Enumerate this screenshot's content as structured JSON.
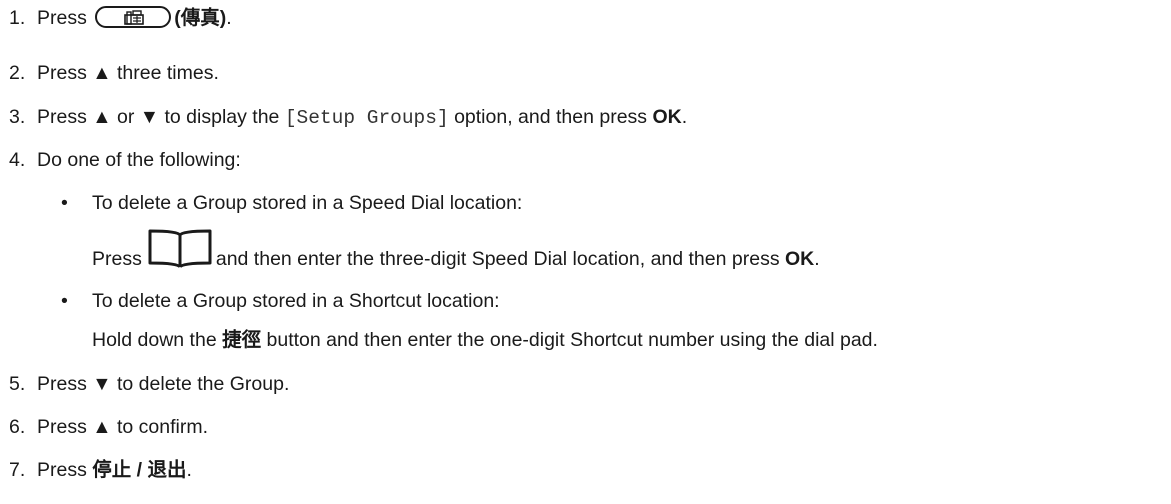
{
  "steps": [
    {
      "num": "1.",
      "pre": "Press",
      "label": "(傳真)",
      "post": "."
    },
    {
      "num": "2.",
      "pre": "Press ",
      "arrow": "▲",
      "post": " three times."
    },
    {
      "num": "3.",
      "pre": "Press ",
      "arrow_up": "▲",
      "mid1": " or ",
      "arrow_down": "▼",
      "mid2": " to display the ",
      "code": "[Setup Groups]",
      "mid3": " option, and then press ",
      "bold": "OK",
      "post": "."
    },
    {
      "num": "4.",
      "text": "Do one of the following:"
    },
    {
      "num": "5.",
      "pre": "Press ",
      "arrow": "▼",
      "post": " to delete the Group."
    },
    {
      "num": "6.",
      "pre": "Press ",
      "arrow": "▲",
      "post": " to confirm."
    },
    {
      "num": "7.",
      "pre": "Press ",
      "bold": "停止 / 退出",
      "post": "."
    }
  ],
  "options": [
    {
      "bullet": "•",
      "heading": "To delete a Group stored in a Speed Dial location:",
      "pre": "Press",
      "mid": "and then enter the three-digit Speed Dial location, and then press ",
      "bold": "OK",
      "post": "."
    },
    {
      "bullet": "•",
      "heading": "To delete a Group stored in a Shortcut location:",
      "pre": "Hold down the ",
      "bold": "捷徑",
      "post": " button and then enter the one-digit Shortcut number using the dial pad."
    }
  ],
  "icons": {
    "fax_key": "fax-key-icon",
    "address_book": "address-book-icon"
  }
}
